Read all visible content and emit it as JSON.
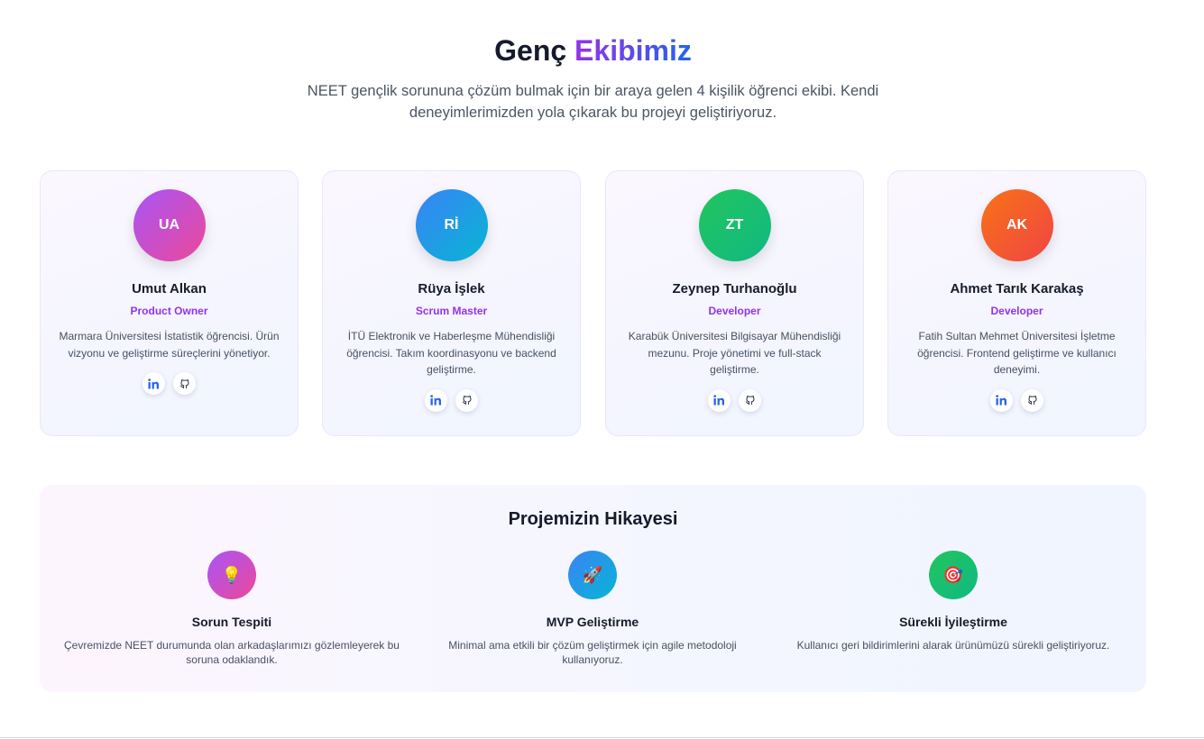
{
  "header": {
    "title_plain": "Genç",
    "title_accent": "Ekibimiz",
    "intro": "NEET gençlik sorununa çözüm bulmak için bir araya gelen 4 kişilik öğrenci ekibi. Kendi deneyimlerimizden yola çıkarak bu projeyi geliştiriyoruz."
  },
  "team": [
    {
      "initials": "UA",
      "name": "Umut Alkan",
      "role": "Product Owner",
      "bio": "Marmara Üniversitesi İstatistik öğrencisi. Ürün vizyonu ve geliştirme süreçlerini yönetiyor.",
      "avatar_color": "purple-pink",
      "socials": [
        "linkedin-icon",
        "github-icon"
      ]
    },
    {
      "initials": "Rİ",
      "name": "Rüya İşlek",
      "role": "Scrum Master",
      "bio": "İTÜ Elektronik ve Haberleşme Mühendisliği öğrencisi. Takım koordinasyonu ve backend geliştirme.",
      "avatar_color": "blue-cyan",
      "socials": [
        "linkedin-icon",
        "github-icon"
      ]
    },
    {
      "initials": "ZT",
      "name": "Zeynep Turhanoğlu",
      "role": "Developer",
      "bio": "Karabük Üniversitesi Bilgisayar Mühendisliği mezunu. Proje yönetimi ve full-stack geliştirme.",
      "avatar_color": "green",
      "socials": [
        "linkedin-icon",
        "github-icon"
      ]
    },
    {
      "initials": "AK",
      "name": "Ahmet Tarık Karakaş",
      "role": "Developer",
      "bio": "Fatih Sultan Mehmet Üniversitesi İşletme öğrencisi. Frontend geliştirme ve kullanıcı deneyimi.",
      "avatar_color": "orange-red",
      "socials": [
        "linkedin-icon",
        "github-icon"
      ]
    }
  ],
  "story": {
    "title": "Projemizin Hikayesi",
    "steps": [
      {
        "icon": "lightbulb-icon",
        "glyph": "💡",
        "title": "Sorun Tespiti",
        "desc": "Çevremizde NEET durumunda olan arkadaşlarımızı gözlemleyerek bu soruna odaklandık."
      },
      {
        "icon": "rocket-icon",
        "glyph": "🚀",
        "title": "MVP Geliştirme",
        "desc": "Minimal ama etkili bir çözüm geliştirmek için agile metodoloji kullanıyoruz."
      },
      {
        "icon": "target-icon",
        "glyph": "🎯",
        "title": "Sürekli İyileştirme",
        "desc": "Kullanıcı geri bildirimlerini alarak ürünümüzü sürekli geliştiriyoruz."
      }
    ]
  },
  "colors": {
    "accent_purple": "#9333ea",
    "accent_blue": "#2563eb",
    "linkedin_blue": "#2563eb"
  }
}
